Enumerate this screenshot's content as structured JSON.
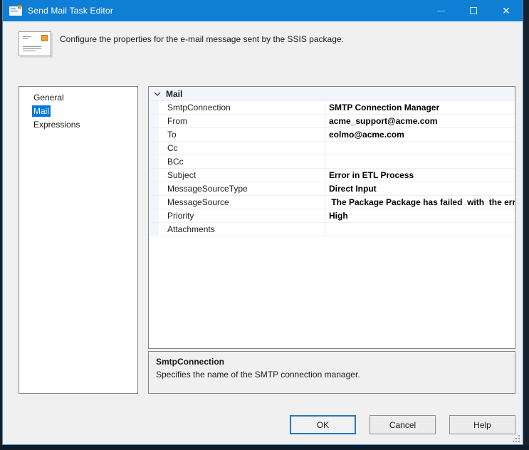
{
  "window": {
    "title": "Send Mail Task Editor",
    "close_glyph": "✕"
  },
  "header": {
    "description": "Configure the properties for the e-mail message sent by the SSIS package."
  },
  "nav": {
    "items": [
      {
        "label": "General",
        "selected": false
      },
      {
        "label": "Mail",
        "selected": true
      },
      {
        "label": "Expressions",
        "selected": false
      }
    ]
  },
  "property_grid": {
    "category": "Mail",
    "rows": [
      {
        "name": "SmtpConnection",
        "value": "SMTP Connection Manager"
      },
      {
        "name": "From",
        "value": "acme_support@acme.com"
      },
      {
        "name": "To",
        "value": "eolmo@acme.com"
      },
      {
        "name": "Cc",
        "value": ""
      },
      {
        "name": "BCc",
        "value": ""
      },
      {
        "name": "Subject",
        "value": "Error in ETL Process"
      },
      {
        "name": "MessageSourceType",
        "value": "Direct Input"
      },
      {
        "name": "MessageSource",
        "value": " The Package Package has failed  with  the error"
      },
      {
        "name": "Priority",
        "value": "High"
      },
      {
        "name": "Attachments",
        "value": ""
      }
    ]
  },
  "description_panel": {
    "title": "SmtpConnection",
    "text": "Specifies the name of the SMTP connection manager."
  },
  "buttons": {
    "ok": "OK",
    "cancel": "Cancel",
    "help": "Help"
  },
  "colors": {
    "titlebar": "#0f7ed5",
    "accent": "#0078d7",
    "body": "#f0f0f0"
  }
}
